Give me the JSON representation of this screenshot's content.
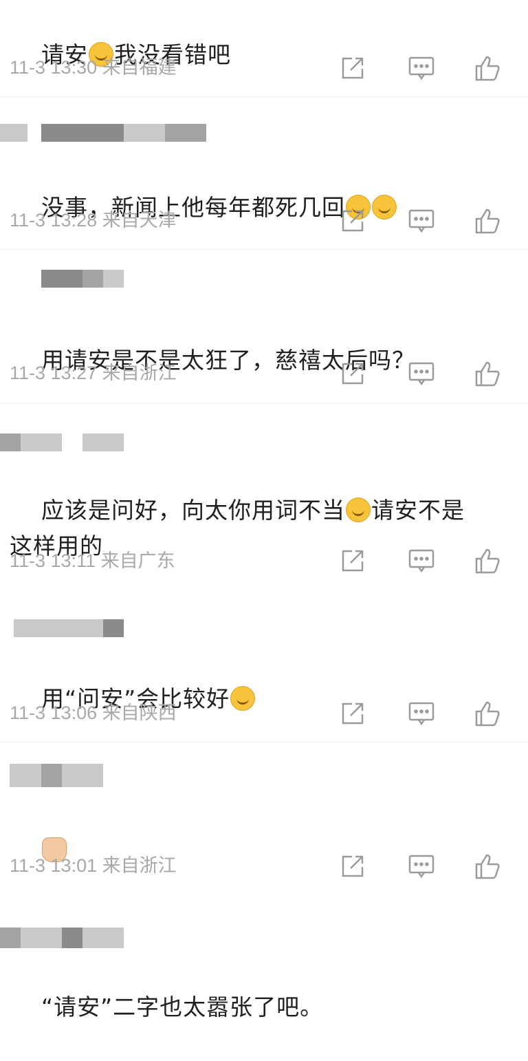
{
  "comments": [
    {
      "text_before": "请安",
      "emoji1": "sleepy-face",
      "text_after": "我没看错吧",
      "time": "11-3 13:30",
      "location": "来自福建"
    },
    {
      "text_before": "没事，新闻上他每年都死几回",
      "emoji1": "tears-of-joy",
      "emoji2": "tears-of-joy",
      "time": "11-3 13:28",
      "location": "来自天津"
    },
    {
      "text_before": "用请安是不是太狂了，慈禧太后吗？",
      "time": "11-3 13:27",
      "location": "来自浙江"
    },
    {
      "text_before": "应该是问好，向太你用词不当",
      "emoji1": "crying-face",
      "text_after": "请安不是",
      "text_line2": "这样用的",
      "time": "11-3 13:11",
      "location": "来自广东"
    },
    {
      "text_before": "用“问安”会比较好",
      "emoji1": "crying-face",
      "time": "11-3 13:06",
      "location": "来自陕西"
    },
    {
      "emoji1": "flexed-biceps",
      "time": "11-3 13:01",
      "location": "来自浙江"
    },
    {
      "text_before": "“请安”二字也太嚣张了吧。"
    }
  ],
  "icons": {
    "share": "share-icon",
    "comment": "comment-icon",
    "like": "thumbs-up-icon"
  },
  "colors": {
    "meta": "#a8a8a8",
    "icon": "#9a9a9a",
    "text": "#1f1f1f",
    "divider": "#eeeeee"
  }
}
